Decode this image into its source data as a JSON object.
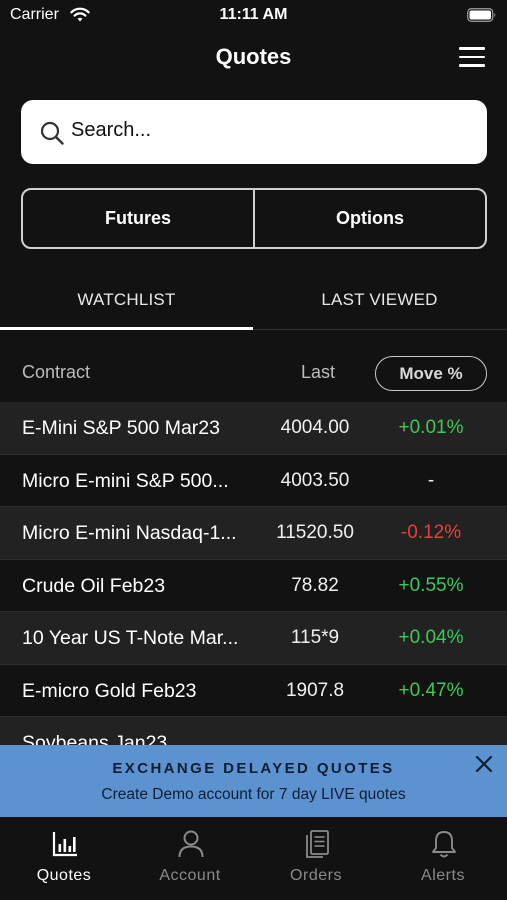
{
  "status": {
    "carrier": "Carrier",
    "time": "11:11 AM"
  },
  "header": {
    "title": "Quotes"
  },
  "search": {
    "placeholder": "Search..."
  },
  "segments": [
    {
      "label": "Futures"
    },
    {
      "label": "Options"
    }
  ],
  "tabs": [
    {
      "label": "WATCHLIST",
      "active": true
    },
    {
      "label": "LAST VIEWED",
      "active": false
    }
  ],
  "table": {
    "headers": {
      "contract": "Contract",
      "last": "Last",
      "move": "Move %"
    },
    "rows": [
      {
        "name": "E-Mini S&P 500 Mar23",
        "last": "4004.00",
        "move": "+0.01%"
      },
      {
        "name": "Micro E-mini S&P 500...",
        "last": "4003.50",
        "move": "-"
      },
      {
        "name": "Micro E-mini Nasdaq-1...",
        "last": "11520.50",
        "move": "-0.12%"
      },
      {
        "name": "Crude Oil Feb23",
        "last": "78.82",
        "move": "+0.55%"
      },
      {
        "name": "10 Year US T-Note Mar...",
        "last": "115*9",
        "move": "+0.04%"
      },
      {
        "name": "E-micro Gold Feb23",
        "last": "1907.8",
        "move": "+0.47%"
      },
      {
        "name": "Soybeans Jan23",
        "last": "",
        "move": ""
      }
    ]
  },
  "banner": {
    "title": "EXCHANGE DELAYED QUOTES",
    "subtitle": "Create Demo account for 7 day LIVE quotes"
  },
  "tabbar": {
    "items": [
      {
        "label": "Quotes",
        "icon": "chart-icon",
        "active": true
      },
      {
        "label": "Account",
        "icon": "person-icon",
        "active": false
      },
      {
        "label": "Orders",
        "icon": "document-icon",
        "active": false
      },
      {
        "label": "Alerts",
        "icon": "bell-icon",
        "active": false
      }
    ]
  },
  "colors": {
    "positive": "#3ec95a",
    "negative": "#e5413b",
    "banner": "#5b92cf",
    "inactive_tab": "#8a8a8a"
  }
}
